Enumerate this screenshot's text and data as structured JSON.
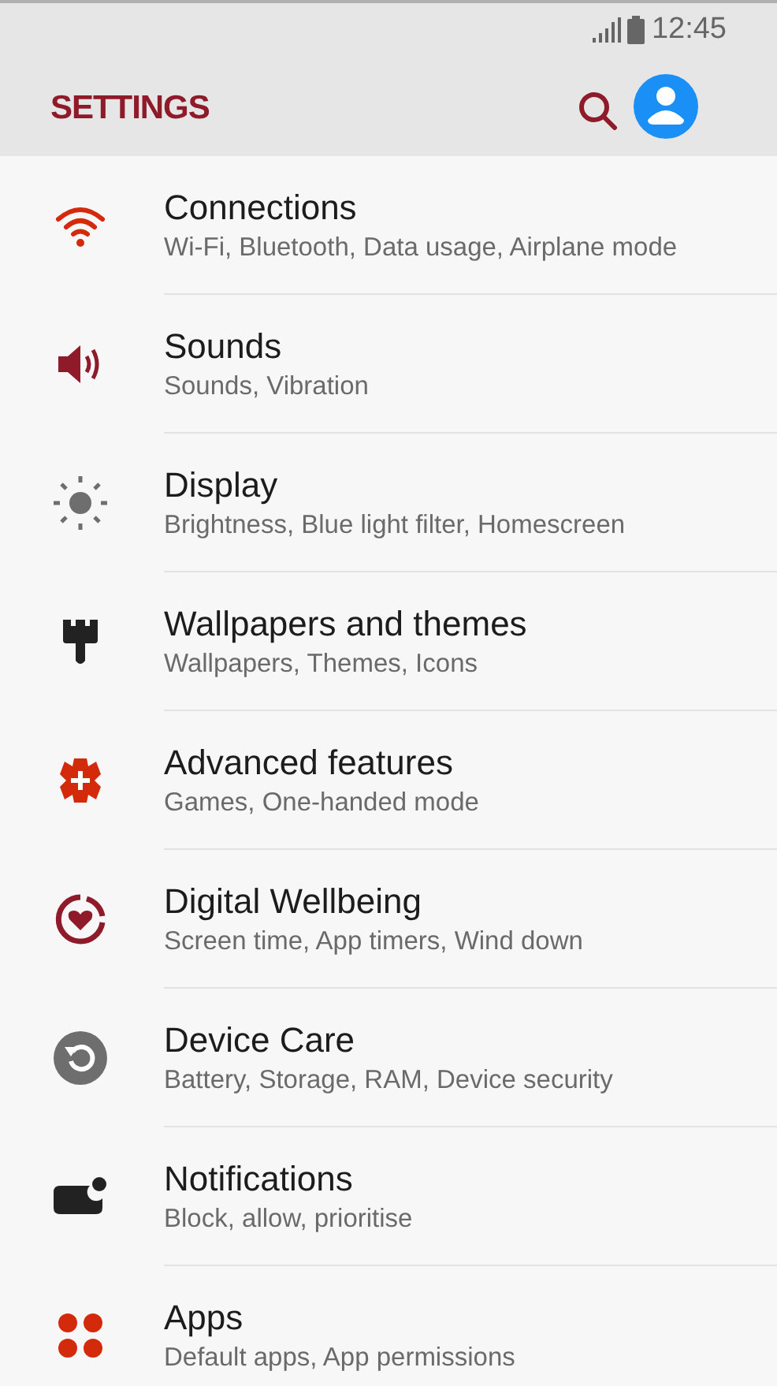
{
  "status_bar": {
    "time": "12:45"
  },
  "header": {
    "title": "SETTINGS"
  },
  "items": [
    {
      "kind": "wifi",
      "title": "Connections",
      "subtitle": "Wi-Fi, Bluetooth, Data usage, Airplane mode"
    },
    {
      "kind": "sound",
      "title": "Sounds",
      "subtitle": "Sounds, Vibration"
    },
    {
      "kind": "display",
      "title": "Display",
      "subtitle": "Brightness, Blue light filter, Homescreen"
    },
    {
      "kind": "brush",
      "title": "Wallpapers and themes",
      "subtitle": "Wallpapers, Themes, Icons"
    },
    {
      "kind": "advanced",
      "title": "Advanced features",
      "subtitle": "Games, One-handed mode"
    },
    {
      "kind": "wellbeing",
      "title": "Digital Wellbeing",
      "subtitle": "Screen time, App timers, Wind down"
    },
    {
      "kind": "care",
      "title": "Device Care",
      "subtitle": "Battery, Storage, RAM, Device security"
    },
    {
      "kind": "notifications",
      "title": "Notifications",
      "subtitle": "Block, allow, prioritise"
    },
    {
      "kind": "apps",
      "title": "Apps",
      "subtitle": "Default apps, App permissions"
    }
  ]
}
